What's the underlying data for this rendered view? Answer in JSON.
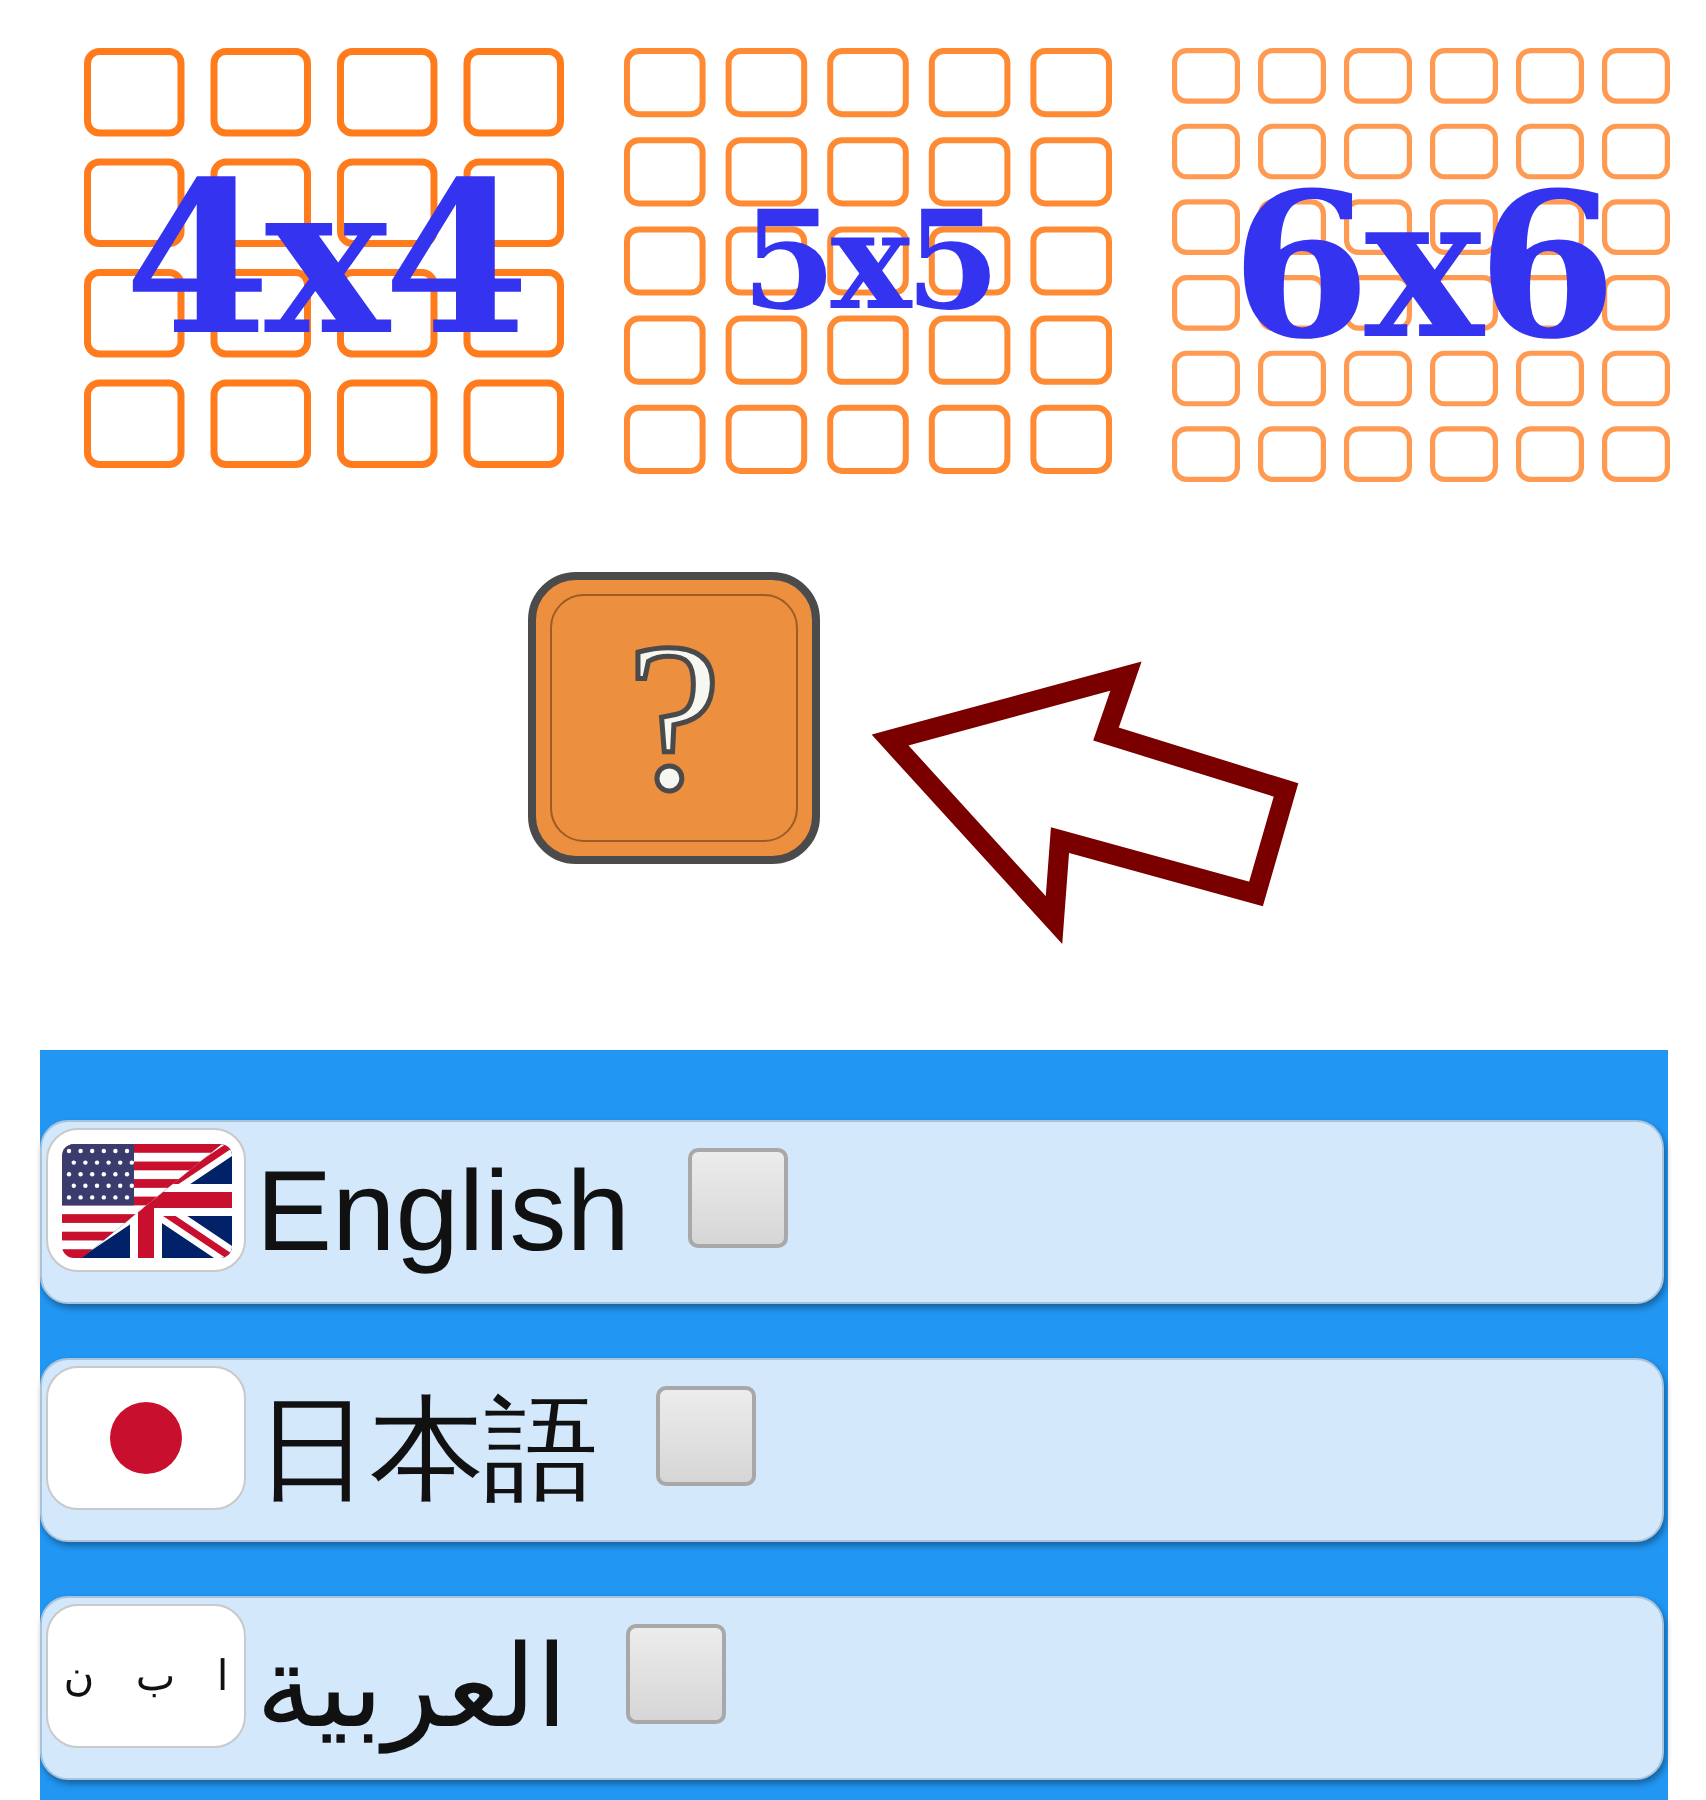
{
  "grid_options": [
    {
      "kind": "small",
      "label": "4x4"
    },
    {
      "kind": "medium",
      "label": "5x5"
    },
    {
      "kind": "large",
      "label": "6x6"
    }
  ],
  "help_button": {
    "symbol": "?"
  },
  "languages": [
    {
      "kind": "anglo",
      "label": "English",
      "checked": false
    },
    {
      "kind": "japan",
      "label": "日本語",
      "checked": false
    },
    {
      "kind": "letters",
      "letters": "ا ب ن",
      "label": "العربية",
      "checked": false
    }
  ]
}
